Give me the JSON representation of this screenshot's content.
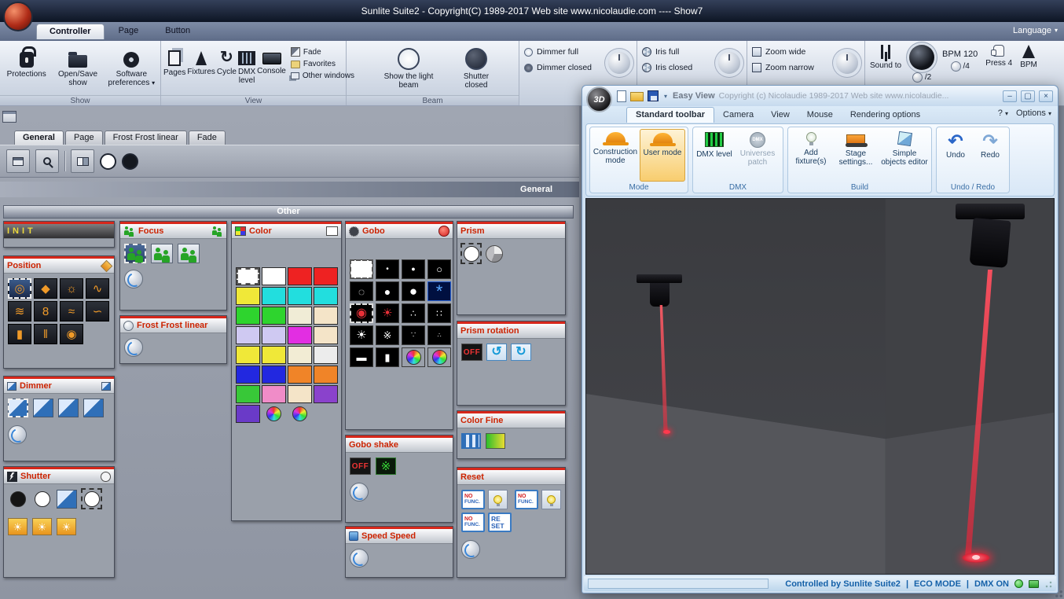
{
  "app": {
    "title": "Sunlite Suite2 - Copyright(C) 1989-2017    Web site www.nicolaudie.com ---- Show7",
    "language": "Language"
  },
  "tabs": {
    "controller": "Controller",
    "page": "Page",
    "button": "Button"
  },
  "icons": {
    "chevron_down": "▾",
    "minimize": "–",
    "maximize": "▢",
    "close": "×",
    "undo": "↶",
    "redo": "↷",
    "ccw": "↺",
    "cw": "↻",
    "cycle": "↻",
    "star": "☀",
    "shake": "※"
  },
  "ribbon": {
    "show": {
      "label": "Show",
      "protections": "Protections",
      "open_save": "Open/Save show",
      "software_preferences": "Software preferences"
    },
    "view": {
      "label": "View",
      "pages": "Pages",
      "fixtures": "Fixtures",
      "cycle": "Cycle",
      "dmx_level": "DMX level",
      "console": "Console",
      "fade": "Fade",
      "favorites": "Favorites",
      "other_windows": "Other windows"
    },
    "beam": {
      "label": "Beam",
      "show_beam": "Show the light beam",
      "shutter_closed": "Shutter closed"
    },
    "dimmer": {
      "full": "Dimmer full",
      "closed": "Dimmer closed"
    },
    "iris": {
      "full": "Iris full",
      "closed": "Iris closed"
    },
    "zoom": {
      "wide": "Zoom wide",
      "narrow": "Zoom narrow"
    },
    "sound": {
      "sound_to": "Sound to",
      "bpm_value": "BPM 120",
      "div2": "/2",
      "div4": "/4",
      "press": "Press 4",
      "bpm": "BPM"
    }
  },
  "doc": {
    "tabs": [
      "General",
      "Page",
      "Frost Frost linear",
      "Fade"
    ],
    "page_label": "General",
    "group_label": "Other"
  },
  "panels": {
    "init": {
      "title": "INIT"
    },
    "position": {
      "title": "Position",
      "icons": [
        {
          "g": "◎",
          "sel": true
        },
        {
          "g": "◆"
        },
        {
          "g": "☼"
        },
        {
          "g": "∿"
        },
        {
          "g": "≋"
        },
        {
          "g": "8"
        },
        {
          "g": "≈"
        },
        {
          "g": "∽"
        },
        {
          "g": "▮"
        },
        {
          "g": "‖"
        },
        {
          "g": "◉"
        }
      ]
    },
    "dimmer": {
      "title": "Dimmer",
      "icons": [
        {
          "sel": true
        },
        {},
        {},
        {}
      ]
    },
    "shutter": {
      "title": "Shutter",
      "row1": [
        {
          "t": "circle",
          "c": "#141414"
        },
        {
          "t": "circle",
          "c": "#ffffff"
        },
        {
          "t": "beam"
        },
        {
          "t": "circle",
          "c": "#ffffff",
          "sel": true
        }
      ],
      "row2": [
        {
          "t": "star"
        },
        {
          "t": "star"
        },
        {
          "t": "star"
        }
      ]
    },
    "focus": {
      "title": "Focus",
      "icons": [
        {
          "sel": true
        },
        {},
        {}
      ]
    },
    "frost": {
      "title": "Frost Frost linear"
    },
    "color": {
      "title": "Color",
      "palette": [
        "sel:#ffffff",
        "#ffffff",
        "#ee2222",
        "#ee2222",
        "#f0e838",
        "#22dede",
        "#22dede",
        "#22dede",
        "#2ed42e",
        "#2ed42e",
        "#f0ecd6",
        "#f4e4c8",
        "#cfc9f2",
        "#cfc9f2",
        "#e22ee2",
        "#f4e4c8",
        "#f0e838",
        "#f0e838",
        "#f2ecd4",
        "#ececec",
        "#2228e0",
        "#2228e0",
        "#f08428",
        "#f08428",
        "#38c838",
        "#f08cc8",
        "#f4e4c8",
        "#8a42cc",
        "#6a3ac8",
        "wheel",
        "wheel",
        "none"
      ]
    },
    "gobo": {
      "title": "Gobo",
      "cells": [
        {
          "bg": "#ffffff",
          "sel": true
        },
        {
          "bg": "#000000",
          "g": "•",
          "fg": "#ffffff",
          "fs": 10
        },
        {
          "bg": "#000000",
          "g": "●",
          "fg": "#ffffff",
          "fs": 9
        },
        {
          "bg": "#000000",
          "g": "○",
          "fg": "#ffffff",
          "fs": 13
        },
        {
          "bg": "#000000",
          "g": "◌",
          "fg": "#ffffff",
          "fs": 14
        },
        {
          "bg": "#000000",
          "g": "●",
          "fg": "#ffffff",
          "fs": 14
        },
        {
          "bg": "#000000",
          "g": "●",
          "fg": "#ffffff",
          "fs": 17
        },
        {
          "bg": "#001040",
          "g": "*",
          "fg": "#58a8ff",
          "fs": 22,
          "bc": "#2860d0"
        },
        {
          "bg": "#000000",
          "g": "◉",
          "fg": "#e83038",
          "fs": 16,
          "sel": true
        },
        {
          "bg": "#000000",
          "g": "☀",
          "fg": "#e83038",
          "fs": 15
        },
        {
          "bg": "#000000",
          "g": "∴",
          "fg": "#ffffff",
          "fs": 12
        },
        {
          "bg": "#000000",
          "g": "∷",
          "fg": "#ffffff",
          "fs": 12
        },
        {
          "bg": "#000000",
          "g": "☀",
          "fg": "#ffffff",
          "fs": 15
        },
        {
          "bg": "#000000",
          "g": "※",
          "fg": "#ffffff",
          "fs": 13
        },
        {
          "bg": "#000000",
          "g": "∵",
          "fg": "#ffffff",
          "fs": 10
        },
        {
          "bg": "#000000",
          "g": "∴",
          "fg": "#ffffff",
          "fs": 8
        },
        {
          "bg": "#000000",
          "g": "▬",
          "fg": "#ffffff",
          "fs": 13
        },
        {
          "bg": "#000000",
          "g": "▮",
          "fg": "#ffffff",
          "fs": 13
        },
        {
          "wheel": true
        },
        {
          "wheel": true
        }
      ]
    },
    "gobo_shake": {
      "title": "Gobo shake",
      "off": "OFF",
      "icons": [
        {
          "t": "off"
        },
        {
          "t": "shake"
        }
      ]
    },
    "speed": {
      "title": "Speed Speed"
    },
    "prism": {
      "title": "Prism",
      "icons": [
        {
          "t": "dash"
        },
        {
          "t": "pie"
        }
      ]
    },
    "prism_rotation": {
      "title": "Prism rotation",
      "off": "OFF",
      "icons": [
        {
          "t": "off"
        },
        {
          "t": "ccw"
        },
        {
          "t": "cw"
        }
      ]
    },
    "color_fine": {
      "title": "Color Fine",
      "icons": [
        {
          "t": "blue"
        },
        {
          "t": "grad"
        }
      ]
    },
    "reset": {
      "title": "Reset",
      "no": "NO",
      "func": "FUNC.",
      "re": "RE",
      "set": "SET",
      "cells": [
        {
          "t": "nofunc"
        },
        {
          "t": "lamp"
        },
        {
          "t": "nofunc"
        },
        {
          "t": "lamp"
        },
        {
          "t": "nofunc"
        },
        {
          "t": "resetbox"
        }
      ]
    }
  },
  "easyview": {
    "logo": "3D",
    "name": "Easy View",
    "copyright": "Copyright (c) Nicolaudie 1989-2017    Web site www.nicolaudie...",
    "menu": {
      "standard": "Standard toolbar",
      "camera": "Camera",
      "view": "View",
      "mouse": "Mouse",
      "rendering": "Rendering options",
      "help": "?",
      "options": "Options"
    },
    "toolbar": {
      "construction": "Construction mode",
      "user": "User mode",
      "dmx_level": "DMX level",
      "universes": "Universes patch",
      "universes_badge": "DMX",
      "add": "Add fixture(s)",
      "stage": "Stage settings...",
      "objects": "Simple objects editor",
      "undo": "Undo",
      "redo": "Redo",
      "g_mode": "Mode",
      "g_dmx": "DMX",
      "g_build": "Build",
      "g_undo": "Undo / Redo"
    },
    "status": {
      "controlled": "Controlled by Sunlite Suite2",
      "sep": "|",
      "eco": "ECO MODE",
      "dmx": "DMX ON"
    }
  }
}
